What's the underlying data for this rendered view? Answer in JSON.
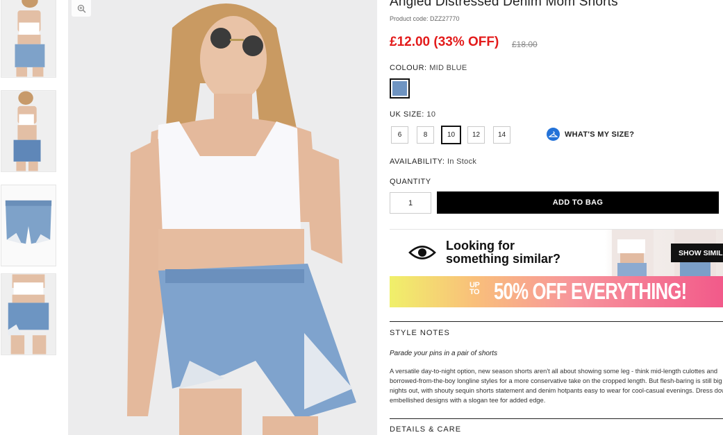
{
  "gallery": {
    "thumbnails": [
      "thumb-front-crop",
      "thumb-side",
      "thumb-product-flat",
      "thumb-back-detail"
    ]
  },
  "product": {
    "title": "Angled Distressed Denim Mom Shorts",
    "code": "Product code: DZZ27770",
    "price": "£12.00 (33% OFF)",
    "was_price": "£18.00",
    "colour_label": "COLOUR:",
    "colour_value": "MID BLUE",
    "swatch_color": "#6f94c1",
    "size_label": "UK SIZE:",
    "size_value": "10",
    "sizes": [
      "6",
      "8",
      "10",
      "12",
      "14"
    ],
    "selected_size": "10",
    "whats_my_size": "WHAT'S MY SIZE?",
    "availability_label": "AVAILABILITY:",
    "availability_value": "In Stock",
    "quantity_label": "QUANTITY",
    "quantity_value": "1",
    "add_to_bag": "ADD TO BAG"
  },
  "similar": {
    "line1": "Looking for",
    "line2": "something similar?",
    "button": "SHOW SIMILAR"
  },
  "promo": {
    "up_to": "UP TO",
    "headline": "50% OFF EVERYTHING!"
  },
  "style_notes": {
    "heading": "STYLE NOTES",
    "tagline": "Parade your pins in a pair of shorts",
    "body": "A versatile day-to-night option, new season shorts aren't all about showing some leg - think mid-length culottes and borrowed-from-the-boy longline styles for a more conservative take on the cropped length. But flesh-baring is still big for nights out, with shouty sequin shorts statement and denim hotpants easy to wear for cool-casual evenings. Dress down embellished designs with a slogan tee for added edge."
  },
  "details_care": {
    "heading": "DETAILS & CARE"
  },
  "colors": {
    "price_red": "#e31b1b",
    "accent_blue": "#2372d8",
    "button_black": "#000000"
  }
}
